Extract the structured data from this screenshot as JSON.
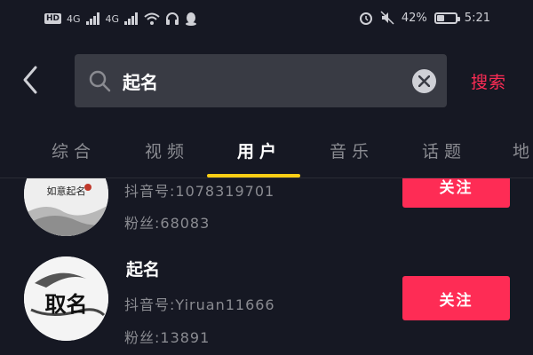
{
  "status_bar": {
    "hd": "HD",
    "net1": "4G",
    "net2": "4G",
    "battery_text": "42%",
    "battery_level": 0.42,
    "time": "5:21"
  },
  "search": {
    "query": "起名",
    "action_label": "搜索"
  },
  "tabs": [
    {
      "label": "综合",
      "active": false
    },
    {
      "label": "视频",
      "active": false
    },
    {
      "label": "用户",
      "active": true
    },
    {
      "label": "音乐",
      "active": false
    },
    {
      "label": "话题",
      "active": false
    },
    {
      "label": "地",
      "active": false
    }
  ],
  "users": [
    {
      "name": "",
      "account_id": "抖音号:1078319701",
      "followers": "粉丝:68083",
      "follow_label": "关注",
      "avatar_text": "如意起名"
    },
    {
      "name": "起名",
      "account_id": "抖音号:Yiruan11666",
      "followers": "粉丝:13891",
      "follow_label": "关注",
      "avatar_text": "取名"
    }
  ],
  "colors": {
    "background": "#161823",
    "accent": "#fe2c55",
    "indicator": "#face15",
    "muted_text": "#8a8b91"
  }
}
